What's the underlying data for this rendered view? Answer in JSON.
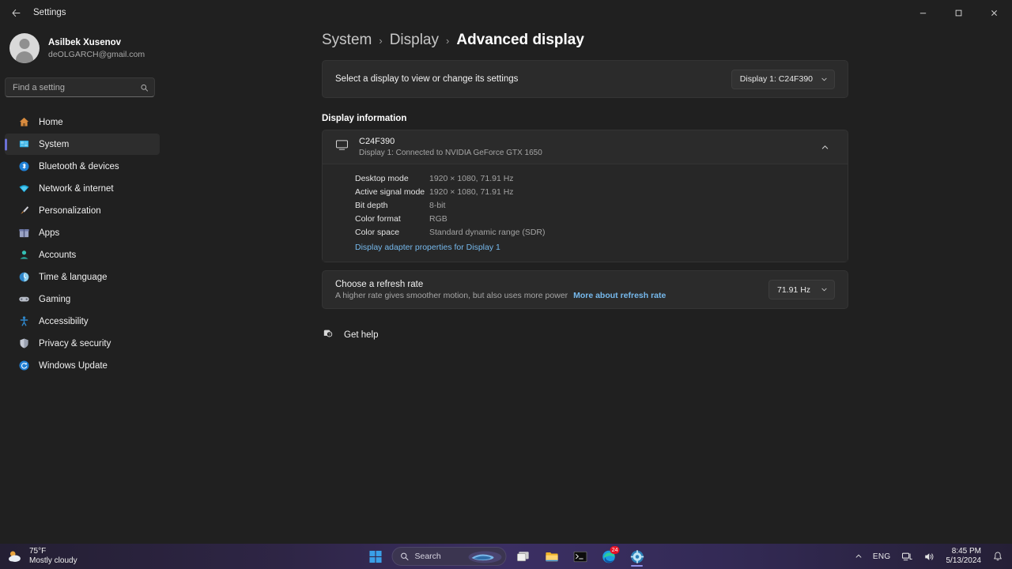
{
  "window": {
    "title": "Settings",
    "back_icon": "back-arrow-icon",
    "minimize": "—",
    "maximize": "□",
    "close": "✕"
  },
  "account": {
    "name": "Asilbek Xusenov",
    "email": "deOLGARCH@gmail.com"
  },
  "search": {
    "placeholder": "Find a setting"
  },
  "sidebar": {
    "items": [
      {
        "label": "Home",
        "icon": "home-icon",
        "active": false
      },
      {
        "label": "System",
        "icon": "system-icon",
        "active": true
      },
      {
        "label": "Bluetooth & devices",
        "icon": "bluetooth-icon",
        "active": false
      },
      {
        "label": "Network & internet",
        "icon": "wifi-icon",
        "active": false
      },
      {
        "label": "Personalization",
        "icon": "brush-icon",
        "active": false
      },
      {
        "label": "Apps",
        "icon": "apps-icon",
        "active": false
      },
      {
        "label": "Accounts",
        "icon": "accounts-icon",
        "active": false
      },
      {
        "label": "Time & language",
        "icon": "clock-globe-icon",
        "active": false
      },
      {
        "label": "Gaming",
        "icon": "gamepad-icon",
        "active": false
      },
      {
        "label": "Accessibility",
        "icon": "accessibility-icon",
        "active": false
      },
      {
        "label": "Privacy & security",
        "icon": "shield-icon",
        "active": false
      },
      {
        "label": "Windows Update",
        "icon": "update-icon",
        "active": false
      }
    ]
  },
  "breadcrumb": {
    "parent1": "System",
    "sep1": "›",
    "parent2": "Display",
    "sep2": "›",
    "current": "Advanced display"
  },
  "select_display": {
    "label": "Select a display to view or change its settings",
    "value": "Display 1: C24F390"
  },
  "display_information": {
    "section_label": "Display information",
    "monitor_name": "C24F390",
    "connection": "Display 1: Connected to NVIDIA GeForce GTX 1650",
    "expanded": true,
    "rows": [
      {
        "key": "Desktop mode",
        "value": "1920 × 1080, 71.91 Hz"
      },
      {
        "key": "Active signal mode",
        "value": "1920 × 1080, 71.91 Hz"
      },
      {
        "key": "Bit depth",
        "value": "8-bit"
      },
      {
        "key": "Color format",
        "value": "RGB"
      },
      {
        "key": "Color space",
        "value": "Standard dynamic range (SDR)"
      }
    ],
    "adapter_link": "Display adapter properties for Display 1"
  },
  "refresh_rate": {
    "title": "Choose a refresh rate",
    "description": "A higher rate gives smoother motion, but also uses more power",
    "link": "More about refresh rate",
    "value": "71.91 Hz"
  },
  "get_help": {
    "label": "Get help",
    "icon": "help-icon"
  },
  "taskbar": {
    "weather": {
      "temperature": "75°F",
      "condition": "Mostly cloudy",
      "icon": "sun-cloud-icon"
    },
    "start": "start-icon",
    "search_label": "Search",
    "apps": [
      {
        "name": "copilot-icon",
        "badge": ""
      },
      {
        "name": "task-view-icon",
        "badge": ""
      },
      {
        "name": "file-explorer-icon",
        "badge": ""
      },
      {
        "name": "terminal-icon",
        "badge": ""
      },
      {
        "name": "edge-icon",
        "badge": "24"
      },
      {
        "name": "settings-icon",
        "badge": ""
      }
    ],
    "tray": {
      "chevron": "show-hidden-icons",
      "language": "ENG",
      "network": "network-icon",
      "volume": "volume-icon",
      "time": "8:45 PM",
      "date": "5/13/2024",
      "notifications": "bell-icon"
    }
  },
  "colors": {
    "accent": "#6b70d6",
    "link": "#76b9ed",
    "page_bg": "#202020",
    "card_bg": "#2b2b2b",
    "badge": "#e81123"
  }
}
